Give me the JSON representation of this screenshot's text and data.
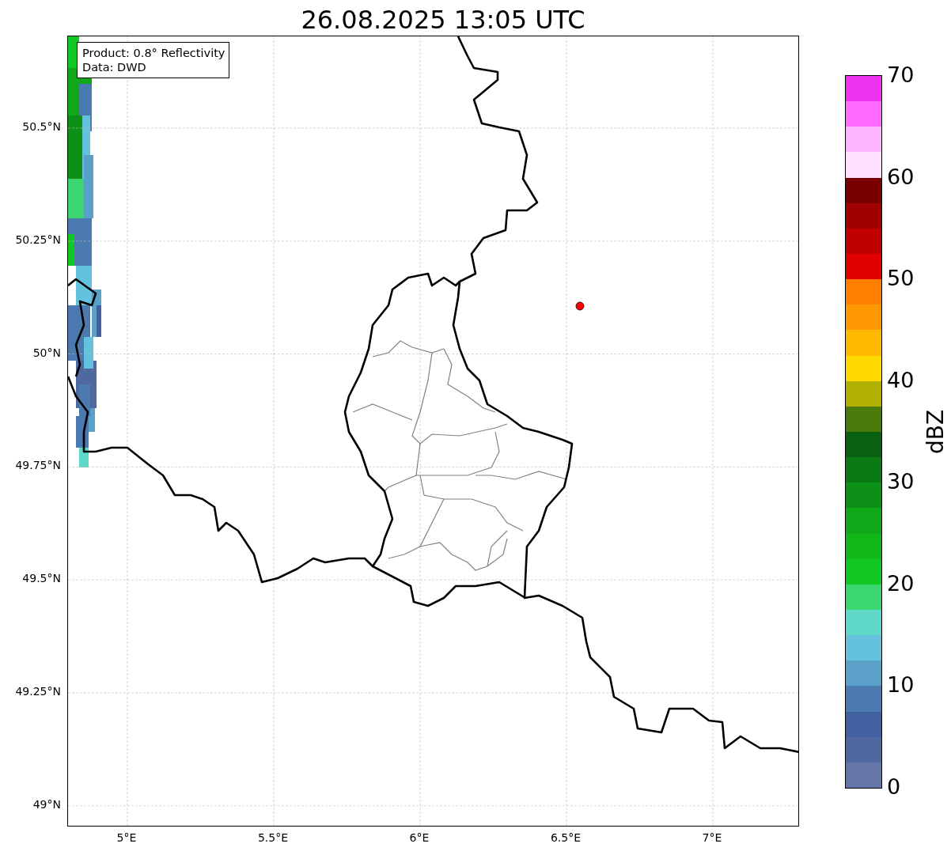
{
  "title": "26.08.2025 13:05 UTC",
  "info_box": [
    "Product: 0.8° Reflectivity",
    "Data: DWD"
  ],
  "lat_labels": [
    "50.5°N",
    "50.25°N",
    "50°N",
    "49.75°N",
    "49.5°N",
    "49.25°N",
    "49°N"
  ],
  "lon_labels": [
    "5°E",
    "5.5°E",
    "6°E",
    "6.5°E",
    "7°E"
  ],
  "colorbar": {
    "label": "dBZ",
    "ticks": [
      "70",
      "60",
      "50",
      "40",
      "30",
      "20",
      "10",
      "0"
    ],
    "bands": [
      {
        "color": "#ee33ee"
      },
      {
        "color": "#ff6cff"
      },
      {
        "color": "#ffb4ff"
      },
      {
        "color": "#ffe0ff"
      },
      {
        "color": "#780000"
      },
      {
        "color": "#a00000"
      },
      {
        "color": "#c00000"
      },
      {
        "color": "#e00000"
      },
      {
        "color": "#ff7f00"
      },
      {
        "color": "#ff9800"
      },
      {
        "color": "#ffb800"
      },
      {
        "color": "#ffd800"
      },
      {
        "color": "#b0b000"
      },
      {
        "color": "#4a7a0a"
      },
      {
        "color": "#086010"
      },
      {
        "color": "#0a7a12"
      },
      {
        "color": "#0c9018"
      },
      {
        "color": "#10a818"
      },
      {
        "color": "#10b818"
      },
      {
        "color": "#10c820"
      },
      {
        "color": "#3cd670"
      },
      {
        "color": "#60d8c8"
      },
      {
        "color": "#64c2dc"
      },
      {
        "color": "#5aa0c8"
      },
      {
        "color": "#4a7ab0"
      },
      {
        "color": "#4260a0"
      },
      {
        "color": "#5068a0"
      },
      {
        "color": "#6475a8"
      }
    ]
  },
  "marker": {
    "color": "#ff0000"
  }
}
